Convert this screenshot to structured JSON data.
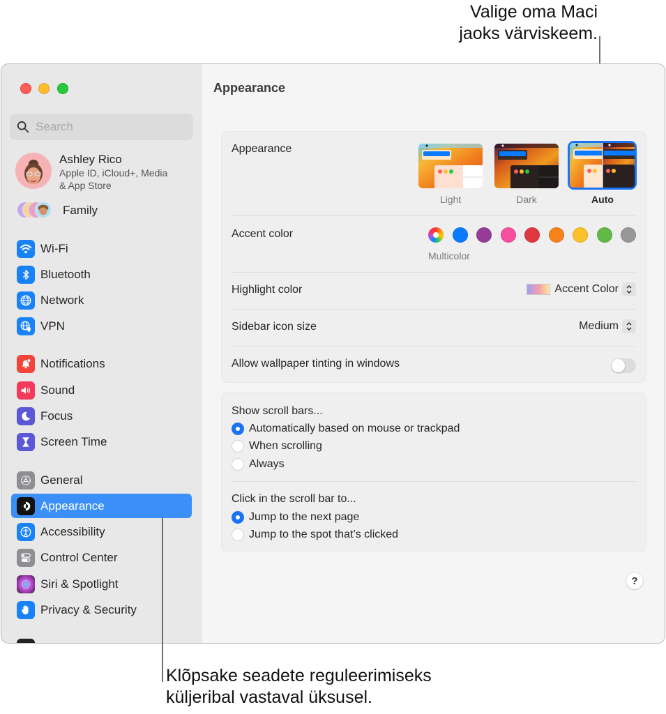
{
  "callouts": {
    "top": [
      "Valige oma Maci",
      "jaoks värviskeem."
    ],
    "bottom": [
      "Klõpsake seadete reguleerimiseks",
      "küljeribal vastaval üksusel."
    ]
  },
  "sidebar": {
    "search_placeholder": "Search",
    "profile": {
      "name": "Ashley Rico",
      "subtitle_line1": "Apple ID, iCloud+, Media",
      "subtitle_line2": "& App Store"
    },
    "family_label": "Family",
    "items": [
      {
        "label": "Wi-Fi",
        "icon": "wifi-icon",
        "color": "#1a82f7"
      },
      {
        "label": "Bluetooth",
        "icon": "bluetooth-icon",
        "color": "#1a82f7"
      },
      {
        "label": "Network",
        "icon": "globe-icon",
        "color": "#1a82f7"
      },
      {
        "label": "VPN",
        "icon": "vpn-globe-shield-icon",
        "color": "#1a82f7"
      },
      {
        "label": "Notifications",
        "icon": "bell-icon",
        "color": "#f0443a"
      },
      {
        "label": "Sound",
        "icon": "speaker-icon",
        "color": "#f33a5a"
      },
      {
        "label": "Focus",
        "icon": "moon-icon",
        "color": "#5b57d6"
      },
      {
        "label": "Screen Time",
        "icon": "hourglass-icon",
        "color": "#5b57d6"
      },
      {
        "label": "General",
        "icon": "gear-icon",
        "color": "#8e8e93"
      },
      {
        "label": "Appearance",
        "icon": "appearance-icon",
        "color": "#111111",
        "selected": true
      },
      {
        "label": "Accessibility",
        "icon": "accessibility-icon",
        "color": "#1a82f7"
      },
      {
        "label": "Control Center",
        "icon": "toggles-icon",
        "color": "#8e8e93"
      },
      {
        "label": "Siri & Spotlight",
        "icon": "siri-icon",
        "color": "#7a3fbf"
      },
      {
        "label": "Privacy & Security",
        "icon": "hand-icon",
        "color": "#1a82f7"
      }
    ]
  },
  "main": {
    "title": "Appearance",
    "appearance": {
      "label": "Appearance",
      "options": [
        {
          "label": "Light",
          "selected": false
        },
        {
          "label": "Dark",
          "selected": false
        },
        {
          "label": "Auto",
          "selected": true
        }
      ]
    },
    "accent": {
      "label": "Accent color",
      "selected_caption": "Multicolor",
      "colors": [
        {
          "name": "multicolor",
          "hex": "multicolor",
          "selected": true
        },
        {
          "name": "blue",
          "hex": "#0a7aff"
        },
        {
          "name": "purple",
          "hex": "#953d96"
        },
        {
          "name": "pink",
          "hex": "#f74f9e"
        },
        {
          "name": "red",
          "hex": "#e0383e"
        },
        {
          "name": "orange",
          "hex": "#f7821b"
        },
        {
          "name": "yellow",
          "hex": "#fcc02b"
        },
        {
          "name": "green",
          "hex": "#62ba46"
        },
        {
          "name": "graphite",
          "hex": "#989898"
        }
      ]
    },
    "highlight": {
      "label": "Highlight color",
      "value": "Accent Color"
    },
    "sidebar_icon_size": {
      "label": "Sidebar icon size",
      "value": "Medium"
    },
    "wallpaper_tinting": {
      "label": "Allow wallpaper tinting in windows",
      "on": false
    },
    "scroll_bars": {
      "label": "Show scroll bars...",
      "options": [
        {
          "label": "Automatically based on mouse or trackpad",
          "selected": true
        },
        {
          "label": "When scrolling",
          "selected": false
        },
        {
          "label": "Always",
          "selected": false
        }
      ]
    },
    "click_scroll": {
      "label": "Click in the scroll bar to...",
      "options": [
        {
          "label": "Jump to the next page",
          "selected": true
        },
        {
          "label": "Jump to the spot that’s clicked",
          "selected": false
        }
      ]
    },
    "help_label": "?"
  },
  "colors": {
    "accent": "#1a73f5",
    "sidebar_selected": "#3a8ff8"
  }
}
